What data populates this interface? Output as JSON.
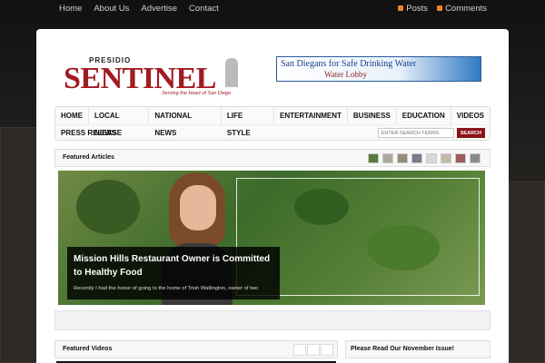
{
  "topbar": {
    "links": [
      "Home",
      "About Us",
      "Advertise",
      "Contact"
    ],
    "feeds": [
      "Posts",
      "Comments"
    ]
  },
  "logo": {
    "presidio": "PRESIDIO",
    "sentinel": "SENTINEL",
    "tagline": "Serving the Heart of San Diego"
  },
  "ad": {
    "line1": "San Diegans for Safe Drinking Water",
    "line2": "Water Lobby"
  },
  "nav": {
    "items": [
      "HOME",
      "LOCAL NEWS",
      "NATIONAL NEWS",
      "LIFE STYLE",
      "ENTERTAINMENT",
      "BUSINESS",
      "EDUCATION",
      "VIDEOS"
    ],
    "row2": "PRESS RELEASE"
  },
  "search": {
    "placeholder": "ENTER SEARCH TERMS",
    "button": "SEARCH"
  },
  "featured": {
    "title": "Featured Articles",
    "headline": "Mission Hills Restaurant Owner is Committed to Healthy Food",
    "excerpt": "Recently I had the honor of going to the home of  Trish Watlington, owner of two"
  },
  "videos": {
    "title": "Featured Videos"
  },
  "sidebar": {
    "title": "Please Read Our November Issue!"
  }
}
